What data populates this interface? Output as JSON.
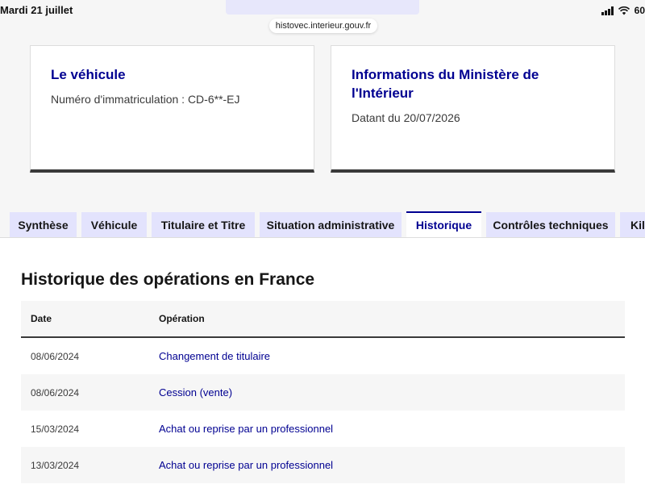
{
  "status_bar": {
    "date": "Mardi 21 juillet",
    "battery": "60",
    "url": "histovec.interieur.gouv.fr"
  },
  "cards": {
    "vehicle": {
      "title": "Le véhicule",
      "registration": "Numéro d'immatriculation : CD-6**-EJ"
    },
    "ministry": {
      "title": "Informations du Ministère de l'Intérieur",
      "date": "Datant du 20/07/2026"
    }
  },
  "tabs": [
    {
      "label": "Synthèse",
      "active": false
    },
    {
      "label": "Véhicule",
      "active": false
    },
    {
      "label": "Titulaire et Titre",
      "active": false
    },
    {
      "label": "Situation administrative",
      "active": false
    },
    {
      "label": "Historique",
      "active": true
    },
    {
      "label": "Contrôles techniques",
      "active": false
    },
    {
      "label": "Kilo",
      "active": false
    }
  ],
  "history": {
    "title": "Historique des opérations en France",
    "columns": {
      "date": "Date",
      "operation": "Opération"
    },
    "rows": [
      {
        "date": "08/06/2024",
        "operation": "Changement de titulaire"
      },
      {
        "date": "08/06/2024",
        "operation": "Cession (vente)"
      },
      {
        "date": "15/03/2024",
        "operation": "Achat ou reprise par un professionnel"
      },
      {
        "date": "13/03/2024",
        "operation": "Achat ou reprise par un professionnel"
      }
    ]
  },
  "colors": {
    "accent": "#000091",
    "tab_background": "#e3e3fd",
    "row_alt": "#f6f6f6"
  }
}
